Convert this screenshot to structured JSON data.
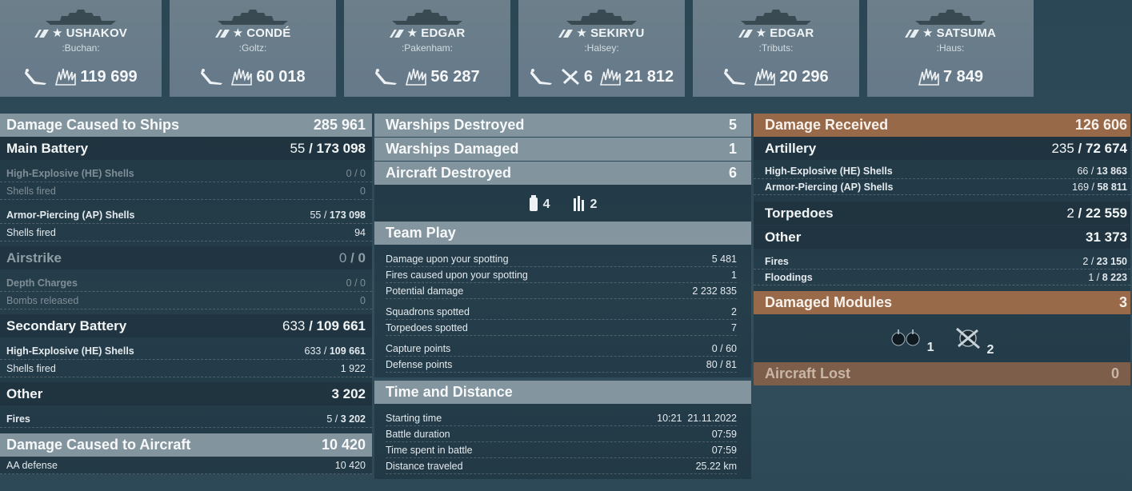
{
  "ships": [
    {
      "name": "USHAKOV",
      "player": ":Buchan:",
      "stats": [
        {
          "icon": "torpedo-hit-icon",
          "value": ""
        },
        {
          "icon": "splash-damage-icon",
          "value": "119 699"
        }
      ]
    },
    {
      "name": "CONDÉ",
      "player": ":Goltz:",
      "stats": [
        {
          "icon": "torpedo-hit-icon",
          "value": ""
        },
        {
          "icon": "splash-damage-icon",
          "value": "60 018"
        }
      ]
    },
    {
      "name": "EDGAR",
      "player": ":Pakenham:",
      "stats": [
        {
          "icon": "torpedo-hit-icon",
          "value": ""
        },
        {
          "icon": "splash-damage-icon",
          "value": "56 287"
        }
      ]
    },
    {
      "name": "SEKIRYU",
      "player": ":Halsey:",
      "stats": [
        {
          "icon": "torpedo-hit-icon",
          "value": ""
        },
        {
          "icon": "plane-shot-down-icon",
          "value": "6"
        },
        {
          "icon": "splash-damage-icon",
          "value": "21 812"
        }
      ]
    },
    {
      "name": "EDGAR",
      "player": ":Tributs:",
      "stats": [
        {
          "icon": "torpedo-hit-icon",
          "value": ""
        },
        {
          "icon": "splash-damage-icon",
          "value": "20 296"
        }
      ]
    },
    {
      "name": "SATSUMA",
      "player": ":Haus:",
      "stats": [
        {
          "icon": "splash-damage-icon",
          "value": "7 849"
        }
      ]
    }
  ],
  "left": {
    "damage_ships": {
      "label": "Damage Caused to Ships",
      "value": "285 961"
    },
    "main_battery": {
      "label": "Main Battery",
      "hits": "55",
      "dmg": "173 098"
    },
    "he_shells": {
      "label": "High-Explosive (HE) Shells",
      "hits": "0",
      "dmg": "0"
    },
    "he_fired": {
      "label": "Shells fired",
      "value": "0"
    },
    "ap_shells": {
      "label": "Armor-Piercing (AP) Shells",
      "hits": "55",
      "dmg": "173 098"
    },
    "ap_fired": {
      "label": "Shells fired",
      "value": "94"
    },
    "airstrike": {
      "label": "Airstrike",
      "hits": "0",
      "dmg": "0"
    },
    "depth": {
      "label": "Depth Charges",
      "hits": "0",
      "dmg": "0"
    },
    "bombs": {
      "label": "Bombs released",
      "value": "0"
    },
    "secondary": {
      "label": "Secondary Battery",
      "hits": "633",
      "dmg": "109 661"
    },
    "sec_he": {
      "label": "High-Explosive (HE) Shells",
      "hits": "633",
      "dmg": "109 661"
    },
    "sec_fired": {
      "label": "Shells fired",
      "value": "1 922"
    },
    "other": {
      "label": "Other",
      "value": "3 202"
    },
    "fires": {
      "label": "Fires",
      "hits": "5",
      "dmg": "3 202"
    },
    "damage_aircraft": {
      "label": "Damage Caused to Aircraft",
      "value": "10 420"
    },
    "aa": {
      "label": "AA defense",
      "value": "10 420"
    }
  },
  "mid": {
    "warships_destroyed": {
      "label": "Warships Destroyed",
      "value": "5"
    },
    "warships_damaged": {
      "label": "Warships Damaged",
      "value": "1"
    },
    "aircraft_destroyed": {
      "label": "Aircraft Destroyed",
      "value": "6"
    },
    "icon_a": "4",
    "icon_b": "2",
    "team_play": "Team Play",
    "spot_dmg": {
      "label": "Damage upon your spotting",
      "value": "5 481"
    },
    "spot_fires": {
      "label": "Fires caused upon your spotting",
      "value": "1"
    },
    "potential": {
      "label": "Potential damage",
      "value": "2 232 835"
    },
    "squadrons": {
      "label": "Squadrons spotted",
      "value": "2"
    },
    "torps": {
      "label": "Torpedoes spotted",
      "value": "7"
    },
    "capture": {
      "label": "Capture points",
      "value": "0 / 60"
    },
    "defense": {
      "label": "Defense points",
      "value": "80 / 81"
    },
    "time_distance": "Time and Distance",
    "start": {
      "label": "Starting time",
      "time": "10:21",
      "date": "21.11.2022"
    },
    "duration": {
      "label": "Battle duration",
      "value": "07:59"
    },
    "spent": {
      "label": "Time spent in battle",
      "value": "07:59"
    },
    "distance": {
      "label": "Distance traveled",
      "value": "25.22 km"
    }
  },
  "right": {
    "damage_received": {
      "label": "Damage Received",
      "value": "126 606"
    },
    "artillery": {
      "label": "Artillery",
      "hits": "235",
      "dmg": "72 674"
    },
    "he": {
      "label": "High-Explosive (HE) Shells",
      "hits": "66",
      "dmg": "13 863"
    },
    "ap": {
      "label": "Armor-Piercing (AP) Shells",
      "hits": "169",
      "dmg": "58 811"
    },
    "torpedoes": {
      "label": "Torpedoes",
      "hits": "2",
      "dmg": "22 559"
    },
    "other": {
      "label": "Other",
      "value": "31 373"
    },
    "fires": {
      "label": "Fires",
      "hits": "2",
      "dmg": "23 150"
    },
    "floodings": {
      "label": "Floodings",
      "hits": "1",
      "dmg": "8 223"
    },
    "modules": {
      "label": "Damaged Modules",
      "value": "3"
    },
    "mod_a": "1",
    "mod_b": "2",
    "aircraft_lost": {
      "label": "Aircraft Lost",
      "value": "0"
    }
  }
}
